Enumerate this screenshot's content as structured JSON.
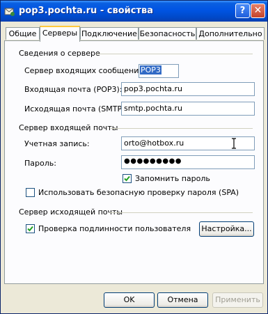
{
  "window": {
    "title": "pop3.pochta.ru - свойства",
    "help_label": "?",
    "close_label": "✕"
  },
  "tabs": [
    {
      "label": "Общие"
    },
    {
      "label": "Серверы"
    },
    {
      "label": "Подключение"
    },
    {
      "label": "Безопасность"
    },
    {
      "label": "Дополнительно"
    }
  ],
  "server_info": {
    "heading": "Сведения о сервере",
    "incoming_type_label": "Сервер входящих сообщений:",
    "incoming_type_value": "POP3",
    "incoming_label": "Входящая почта (POP3):",
    "incoming_value": "pop3.pochta.ru",
    "outgoing_label": "Исходящая почта (SMTP):",
    "outgoing_value": "smtp.pochta.ru"
  },
  "incoming_server": {
    "heading": "Сервер входящей почты",
    "account_label": "Учетная запись:",
    "account_value": "orto@hotbox.ru",
    "password_label": "Пароль:",
    "password_value": "●●●●●●●●●",
    "remember_label": "Запомнить пароль",
    "remember_checked": true,
    "spa_label": "Использовать безопасную проверку пароля (SPA)",
    "spa_checked": false
  },
  "outgoing_server": {
    "heading": "Сервер исходящей почты",
    "auth_label": "Проверка подлинности пользователя",
    "auth_checked": true,
    "settings_button": "Настройка..."
  },
  "footer": {
    "ok": "OK",
    "cancel": "Отмена",
    "apply": "Применить"
  },
  "colors": {
    "titlebar": "#0054e3",
    "tab_highlight": "#ffc83c",
    "selection": "#316ac5",
    "check": "#21a121"
  }
}
